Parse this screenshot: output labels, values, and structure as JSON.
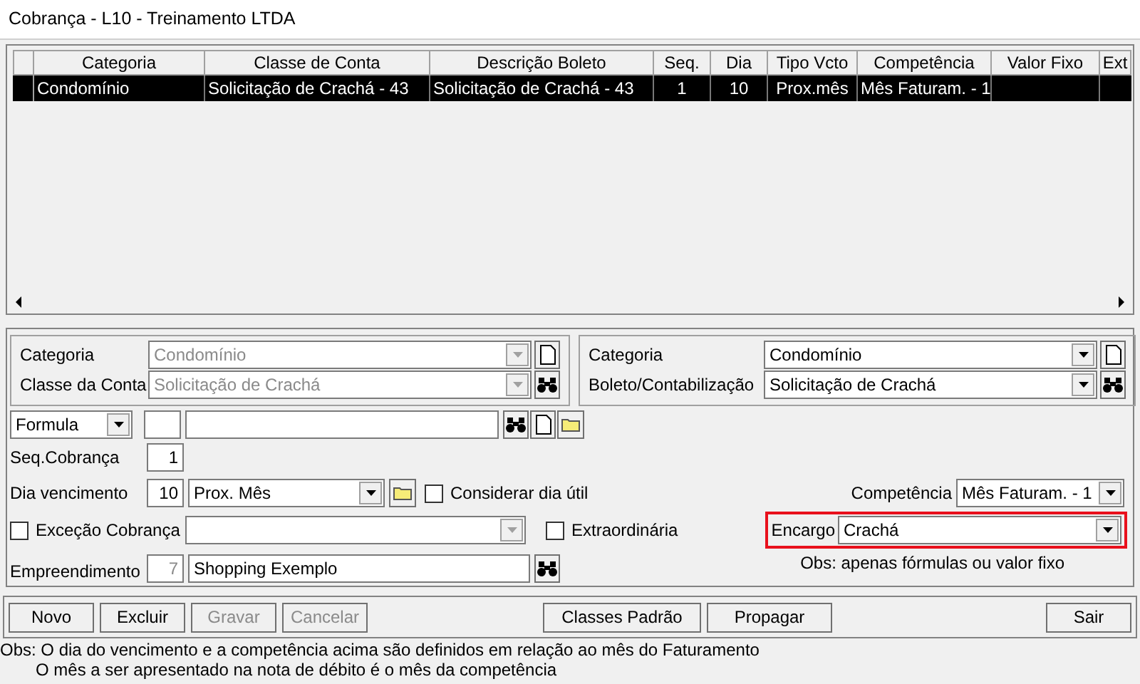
{
  "window": {
    "title": "Cobrança - L10 - Treinamento LTDA"
  },
  "table": {
    "columns": [
      "Categoria",
      "Classe de Conta",
      "Descrição Boleto",
      "Seq.",
      "Dia",
      "Tipo Vcto",
      "Competência",
      "Valor Fixo",
      "Ext"
    ],
    "rows": [
      {
        "selected": true,
        "cells": [
          "Condomínio",
          "Solicitação de Crachá - 43",
          "Solicitação de Crachá - 43",
          "1",
          "10",
          "Prox.mês",
          "Mês Faturam. - 1",
          ""
        ]
      }
    ]
  },
  "filter_left": [
    {
      "label": "Categoria",
      "value": "Condomínio",
      "disabled": true,
      "kind": "new"
    },
    {
      "label": "Classe da Conta",
      "value": "Solicitação de Crachá",
      "disabled": true,
      "kind": "search"
    }
  ],
  "filter_right": [
    {
      "label": "Categoria",
      "value": "Condomínio",
      "disabled": false,
      "kind": "new"
    },
    {
      "label": "Boleto/Contabilização",
      "value": "Solicitação de Crachá",
      "disabled": false,
      "kind": "search"
    }
  ],
  "formula": {
    "type": "Formula"
  },
  "seq_cobranca": {
    "label": "Seq.Cobrança",
    "value": "1"
  },
  "dia_vencimento": {
    "label": "Dia vencimento",
    "value": "10",
    "mode": "Prox. Mês"
  },
  "considerar_dia_util": {
    "label": "Considerar dia útil",
    "checked": false
  },
  "competencia": {
    "label": "Competência",
    "value": "Mês Faturam. - 1"
  },
  "excecao_cobranca": {
    "label": "Exceção Cobrança",
    "checked": false,
    "disabled": true
  },
  "extraordinaria": {
    "label": "Extraordinária",
    "checked": false
  },
  "encargo": {
    "label": "Encargo",
    "value": "Crachá",
    "highlighted": true,
    "note": "Obs: apenas fórmulas ou valor fixo"
  },
  "empreendimento": {
    "label": "Empreendimento",
    "code": "7",
    "code_disabled": true,
    "name": "Shopping Exemplo"
  },
  "buttons": {
    "left": [
      {
        "label": "Novo",
        "disabled": false
      },
      {
        "label": "Excluir",
        "disabled": false
      },
      {
        "label": "Gravar",
        "disabled": true
      },
      {
        "label": "Cancelar",
        "disabled": true
      }
    ],
    "center": [
      {
        "label": "Classes Padrão",
        "disabled": false
      },
      {
        "label": "Propagar",
        "disabled": false
      }
    ],
    "right": [
      {
        "label": "Sair",
        "disabled": false
      }
    ]
  },
  "notes": [
    "Obs: O dia do vencimento e a competência acima são definidos em relação ao mês do Faturamento",
    "O mês a ser apresentado na nota de débito é o mês da competência"
  ]
}
